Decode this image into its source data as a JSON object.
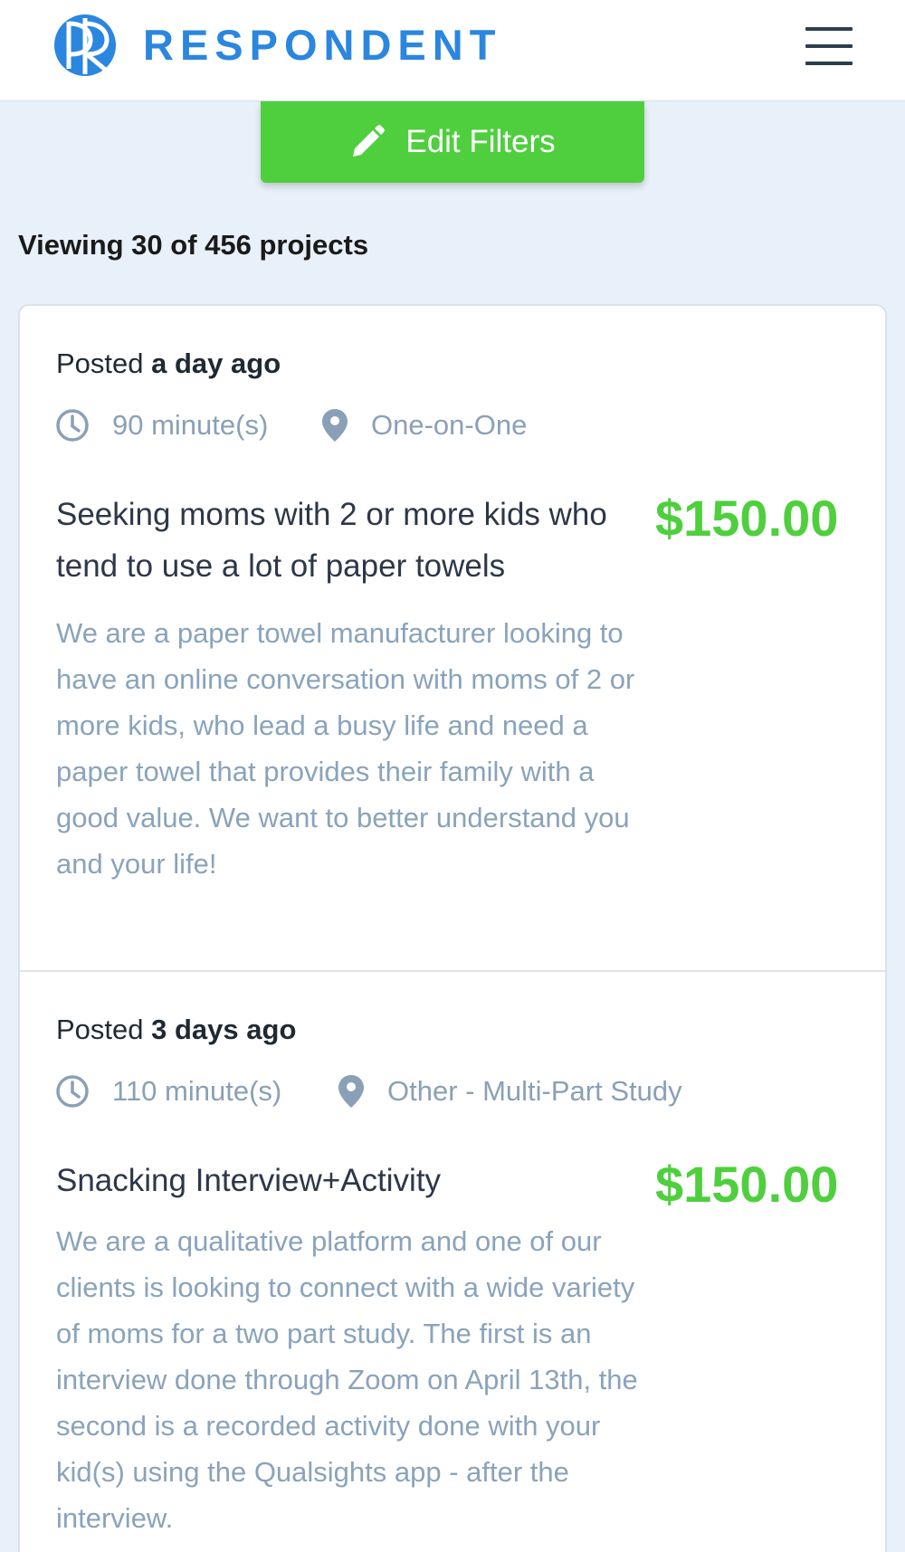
{
  "header": {
    "brand_name": "RESPONDENT",
    "logo_icon": "respondent-logo-icon",
    "menu_icon": "hamburger-menu-icon",
    "brand_color": "#2b86df"
  },
  "filters": {
    "button_label": "Edit Filters",
    "icon": "pencil-icon",
    "button_color": "#4fcf3e"
  },
  "results": {
    "count_text": "Viewing 30 of 456 projects"
  },
  "projects": [
    {
      "posted_prefix": "Posted",
      "posted_when": "a day ago",
      "duration": "90 minute(s)",
      "format": "One-on-One",
      "title": "Seeking moms with 2 or more kids who tend to use a lot of paper towels",
      "price": "$150.00",
      "description": "We are a paper towel manufacturer looking to have an online conversation with moms of 2 or more kids, who lead a busy life and need a paper towel that provides their family with a good value. We want to better understand you and your life!"
    },
    {
      "posted_prefix": "Posted",
      "posted_when": "3 days ago",
      "duration": "110 minute(s)",
      "format": "Other - Multi-Part Study",
      "title": "Snacking Interview+Activity",
      "price": "$150.00",
      "description": "We are a qualitative platform and one of our clients is looking to connect with a wide variety of moms for a two part study. The first is an interview done through Zoom on April 13th, the second is a recorded activity done with your kid(s) using the Qualsights app - after the interview."
    }
  ]
}
